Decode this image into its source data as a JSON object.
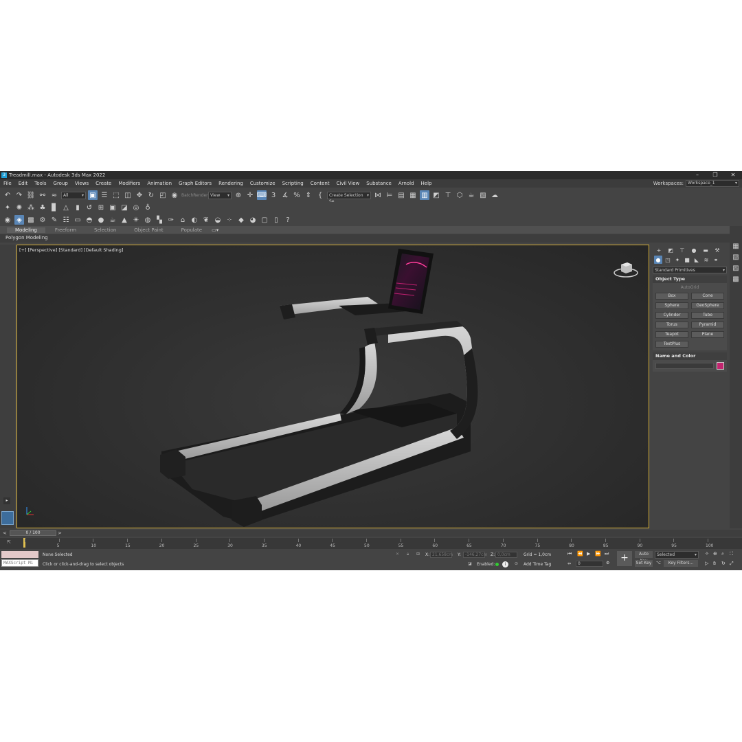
{
  "app": {
    "window_title": "Treadmill.max - Autodesk 3ds Max 2022",
    "logo_text": "3",
    "win_buttons": [
      "–",
      "❐",
      "✕"
    ]
  },
  "menu": [
    "File",
    "Edit",
    "Tools",
    "Group",
    "Views",
    "Create",
    "Modifiers",
    "Animation",
    "Graph Editors",
    "Rendering",
    "Customize",
    "Scripting",
    "Content",
    "Civil View",
    "Substance",
    "Arnold",
    "Help"
  ],
  "workspace": {
    "label": "Workspaces:",
    "value": "Workspace_1"
  },
  "toolbar": {
    "filter_value": "All",
    "batch_render": "BatchRender",
    "coord_value": "View",
    "snap_value": "3",
    "selection_set": "Create Selection Se"
  },
  "ribbon": {
    "tabs": [
      "Modeling",
      "Freeform",
      "Selection",
      "Object Paint",
      "Populate"
    ],
    "active_tab": "Modeling",
    "panel_label": "Polygon Modeling"
  },
  "viewport": {
    "label": "[+] [Perspective] [Standard] [Default Shading]"
  },
  "command_panel": {
    "category": "Standard Primitives",
    "object_type_title": "Object Type",
    "autogrid": "AutoGrid",
    "buttons": [
      "Box",
      "Cone",
      "Sphere",
      "GeoSphere",
      "Cylinder",
      "Tube",
      "Torus",
      "Pyramid",
      "Teapot",
      "Plane",
      "TextPlus"
    ],
    "name_color_title": "Name and Color",
    "object_color": "#c2256f"
  },
  "timeline": {
    "frame_display": "0 / 100",
    "ticks": [
      "0",
      "5",
      "10",
      "15",
      "20",
      "25",
      "30",
      "35",
      "40",
      "45",
      "50",
      "55",
      "60",
      "65",
      "70",
      "75",
      "80",
      "85",
      "90",
      "95",
      "100"
    ]
  },
  "status": {
    "maxscript_placeholder": "MAXScript Mi",
    "selection": "None Selected",
    "prompt": "Click or click-and-drag to select objects",
    "x_label": "X:",
    "x_value": "21,658cm",
    "y_label": "Y:",
    "y_value": "-146,27cm",
    "z_label": "Z:",
    "z_value": "0,0cm",
    "grid": "Grid = 1,0cm",
    "enabled": "Enabled:",
    "add_time_tag": "Add Time Tag",
    "auto_key": "Auto Key",
    "set_key": "Set Key",
    "key_mode": "Selected",
    "key_filters": "Key Filters...",
    "frame_field": "0"
  }
}
